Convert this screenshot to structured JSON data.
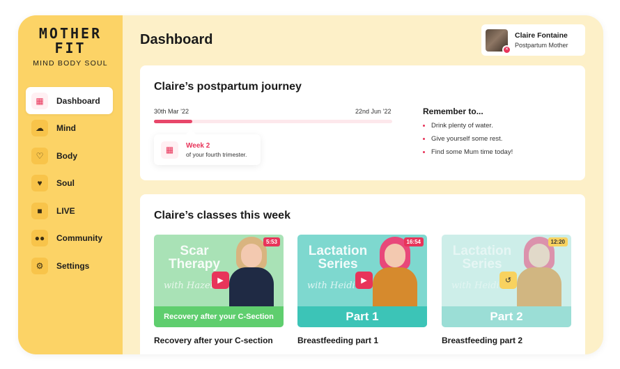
{
  "brand": {
    "line1": "MOTHER",
    "line2": "FIT",
    "tagline": "MIND BODY SOUL"
  },
  "sidebar": {
    "items": [
      {
        "label": "Dashboard",
        "icon": "grid-icon",
        "active": true
      },
      {
        "label": "Mind",
        "icon": "brain-icon",
        "active": false
      },
      {
        "label": "Body",
        "icon": "heartbeat-icon",
        "active": false
      },
      {
        "label": "Soul",
        "icon": "heart-icon",
        "active": false
      },
      {
        "label": "LIVE",
        "icon": "video-camera-icon",
        "active": false
      },
      {
        "label": "Community",
        "icon": "users-icon",
        "active": false
      },
      {
        "label": "Settings",
        "icon": "gear-icon",
        "active": false
      }
    ]
  },
  "header": {
    "title": "Dashboard"
  },
  "profile": {
    "name": "Claire Fontaine",
    "role": "Postpartum Mother"
  },
  "journey": {
    "title": "Claire’s postpartum journey",
    "start_date": "30th Mar ’22",
    "end_date": "22nd Jun ’22",
    "progress": 0.16,
    "week_label": "Week 2",
    "week_sub": "of your fourth trimester.",
    "remember_title": "Remember to...",
    "remember_items": [
      "Drink plenty of water.",
      "Give yourself some rest.",
      "Find some Mum time today!"
    ]
  },
  "classes": {
    "title": "Claire’s classes this week",
    "items": [
      {
        "thumb_title": "Scar Therapy",
        "thumb_sub": "with Hazel",
        "banner": "Recovery after your C-Section",
        "duration": "5:53",
        "title": "Recovery after your C-section",
        "action_icon": "play-icon"
      },
      {
        "thumb_title": "Lactation Series",
        "thumb_sub": "with Heidi",
        "banner": "Part 1",
        "duration": "16:54",
        "title": "Breastfeeding part 1",
        "action_icon": "play-icon"
      },
      {
        "thumb_title": "Lactation Series",
        "thumb_sub": "with Heidi",
        "banner": "Part 2",
        "duration": "12:20",
        "title": "Breastfeeding part 2",
        "action_icon": "replay-icon"
      }
    ]
  },
  "colors": {
    "sidebar": "#fcd366",
    "background": "#fdf0c8",
    "accent": "#e8345a"
  }
}
